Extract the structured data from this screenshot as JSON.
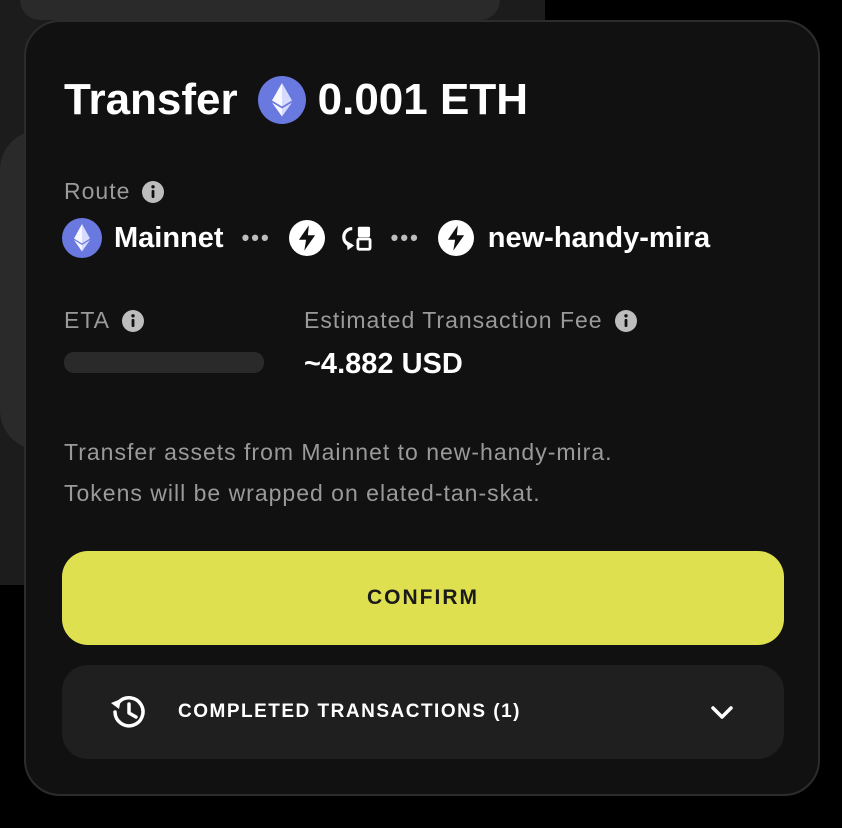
{
  "title": {
    "action": "Transfer",
    "amount": "0.001 ETH",
    "token_icon": "ethereum-icon"
  },
  "route": {
    "label": "Route",
    "source": "Mainnet",
    "destination": "new-handy-mira",
    "icons": [
      "ethereum-icon",
      "lightning-icon",
      "wrap-icon",
      "lightning-icon"
    ]
  },
  "eta": {
    "label": "ETA"
  },
  "fee": {
    "label": "Estimated Transaction Fee",
    "value": "~4.882 USD"
  },
  "description": {
    "line1": "Transfer assets from Mainnet to new-handy-mira.",
    "line2": "Tokens will be wrapped on elated-tan-skat."
  },
  "confirm": {
    "label": "CONFIRM"
  },
  "completed": {
    "label": "COMPLETED TRANSACTIONS (1)"
  },
  "colors": {
    "accent": "#dfe04f",
    "ethereum": "#6a79e0",
    "card": "#111111"
  }
}
